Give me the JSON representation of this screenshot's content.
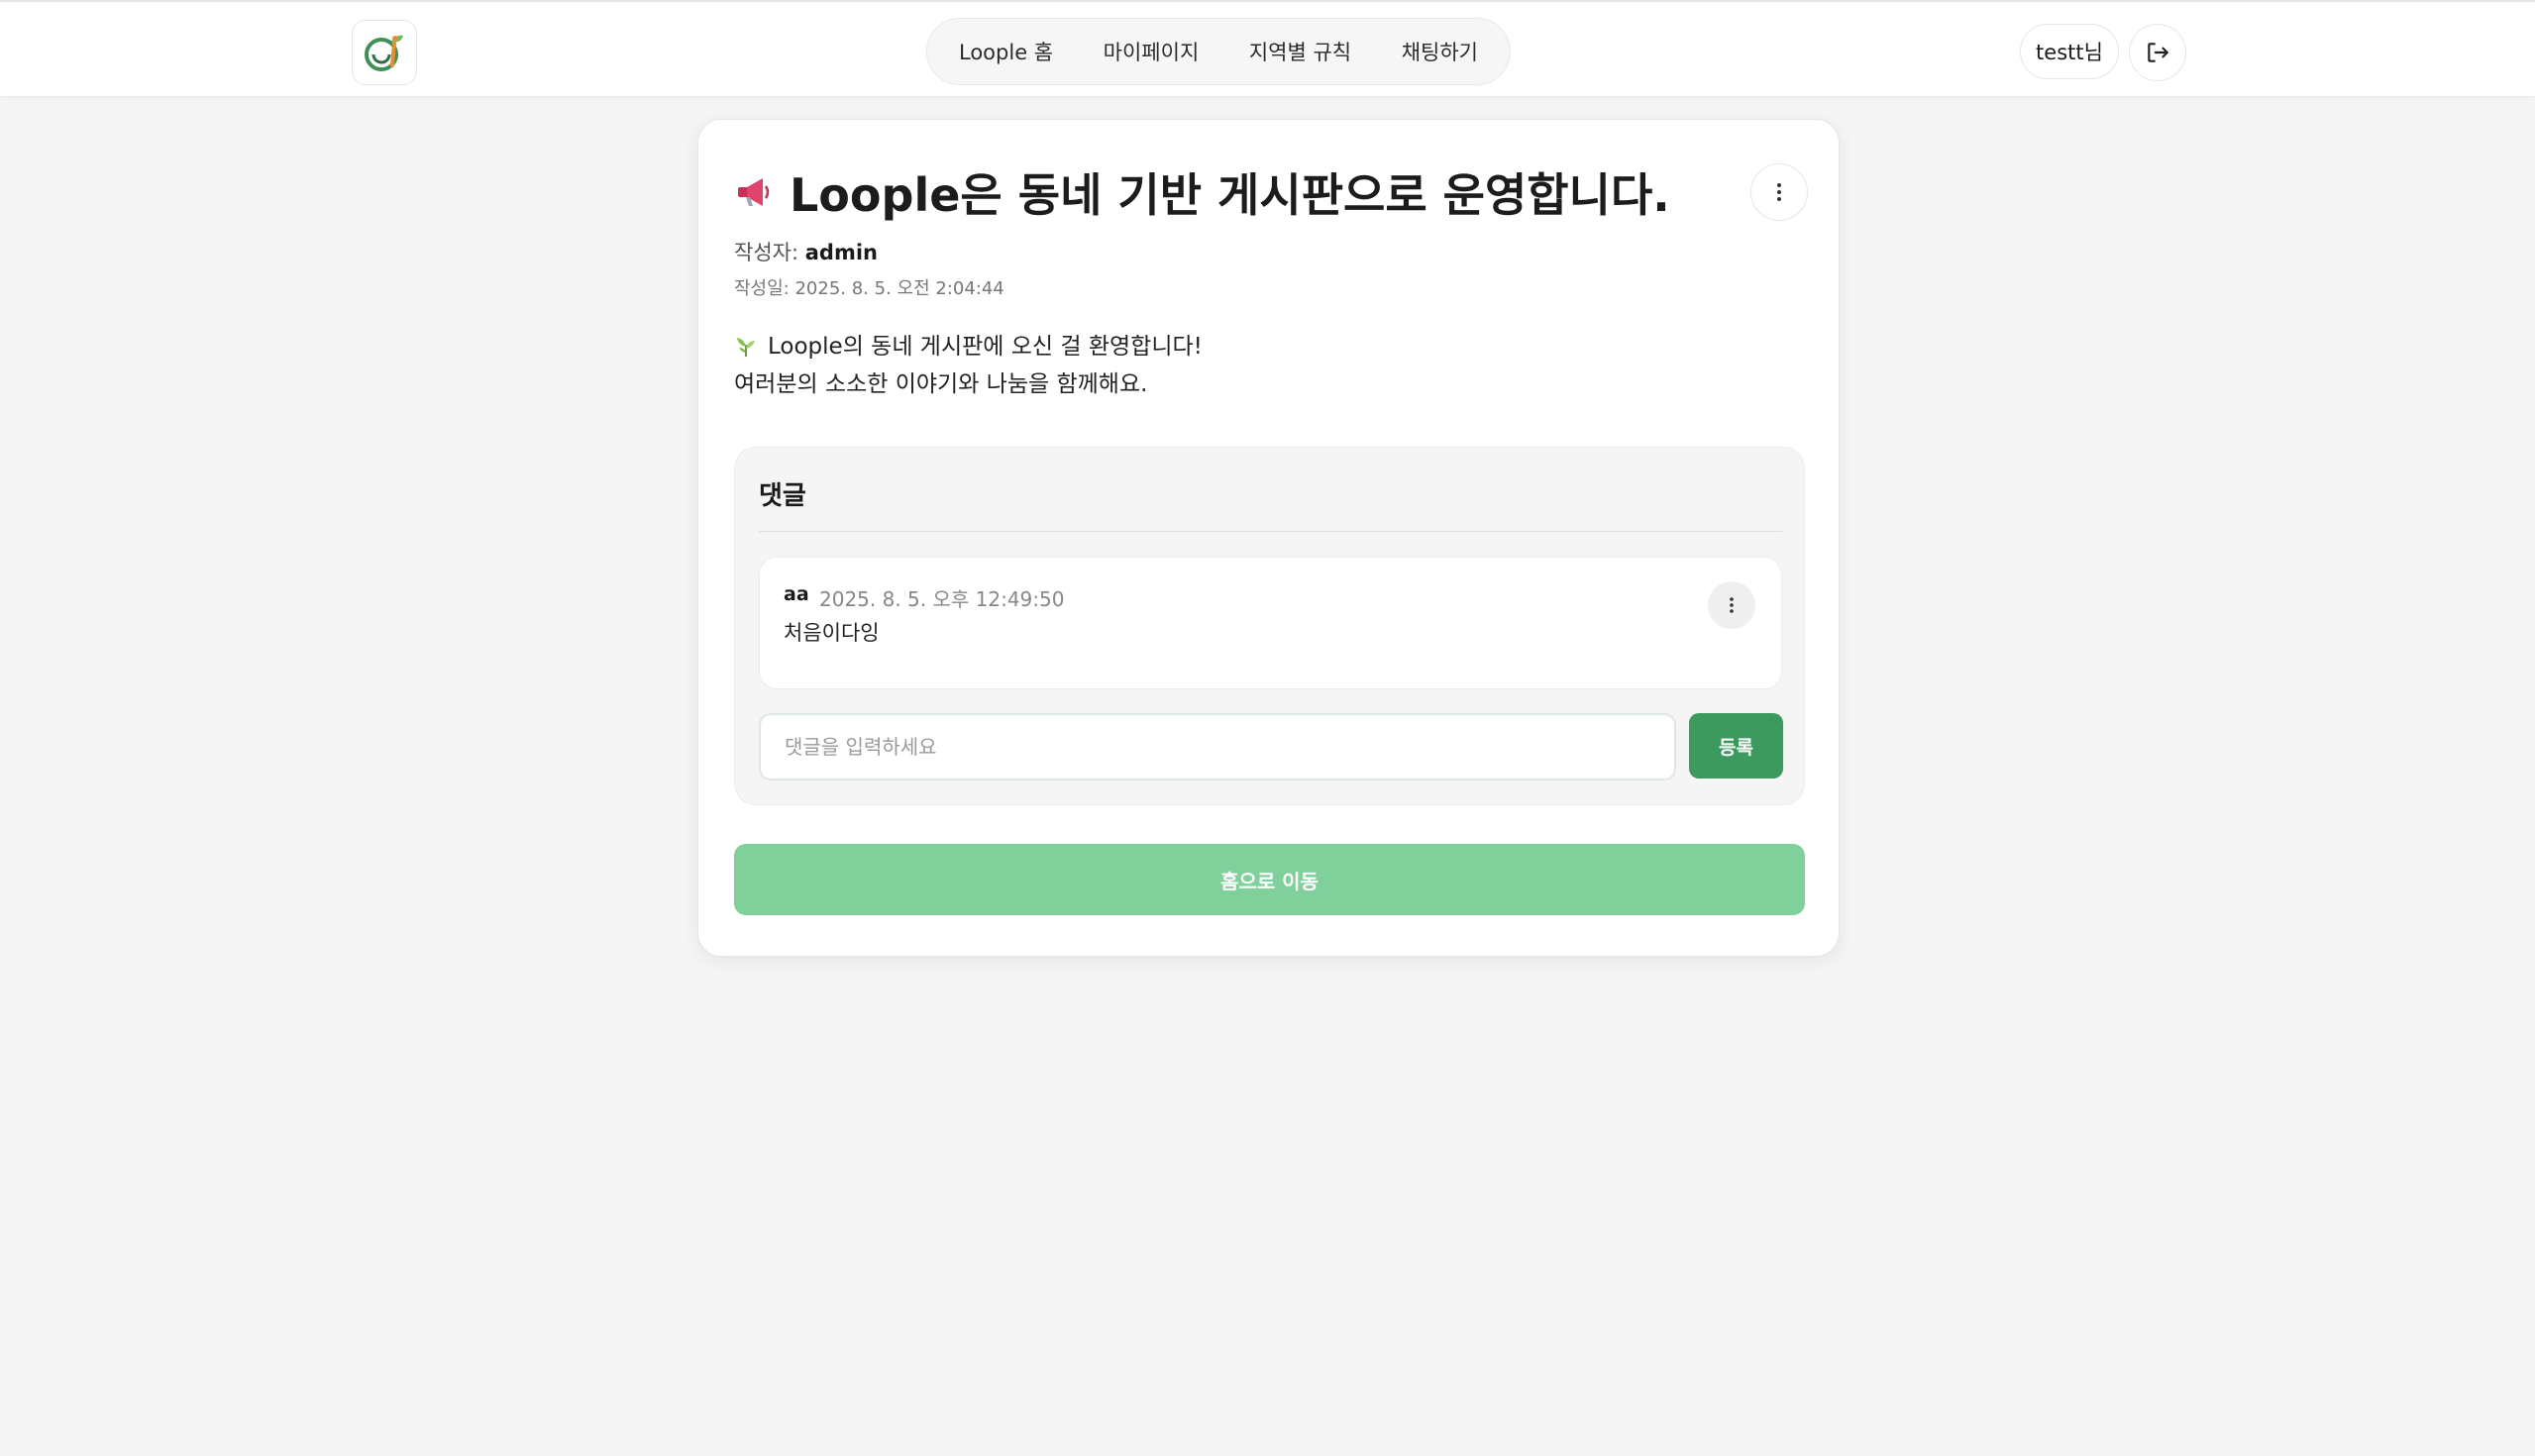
{
  "header": {
    "logo_icon": "loople-logo-icon",
    "nav": [
      {
        "label": "Loople 홈"
      },
      {
        "label": "마이페이지"
      },
      {
        "label": "지역별 규칙"
      },
      {
        "label": "채팅하기"
      }
    ],
    "user_label": "testt님",
    "logout_icon": "logout-icon"
  },
  "post": {
    "icon": "megaphone-icon",
    "title": "Loople은 동네 기반 게시판으로 운영합니다.",
    "author_prefix": "작성자:",
    "author": "admin",
    "created": "작성일: 2025. 8. 5. 오전 2:04:44",
    "content_icon": "sprout-icon",
    "content_line1": "Loople의 동네 게시판에 오신 걸 환영합니다!",
    "content_line2": "여러분의 소소한 이야기와 나눔을 함께해요."
  },
  "comments": {
    "title": "댓글",
    "items": [
      {
        "user": "aa",
        "time": "2025. 8. 5. 오후 12:49:50",
        "text": "처음이다잉"
      }
    ],
    "input_placeholder": "댓글을 입력하세요",
    "submit_label": "등록"
  },
  "home_button_label": "홈으로 이동",
  "colors": {
    "primary_green": "#3d9a5e",
    "light_green": "#7fd09a",
    "background": "#f5f5f5"
  }
}
